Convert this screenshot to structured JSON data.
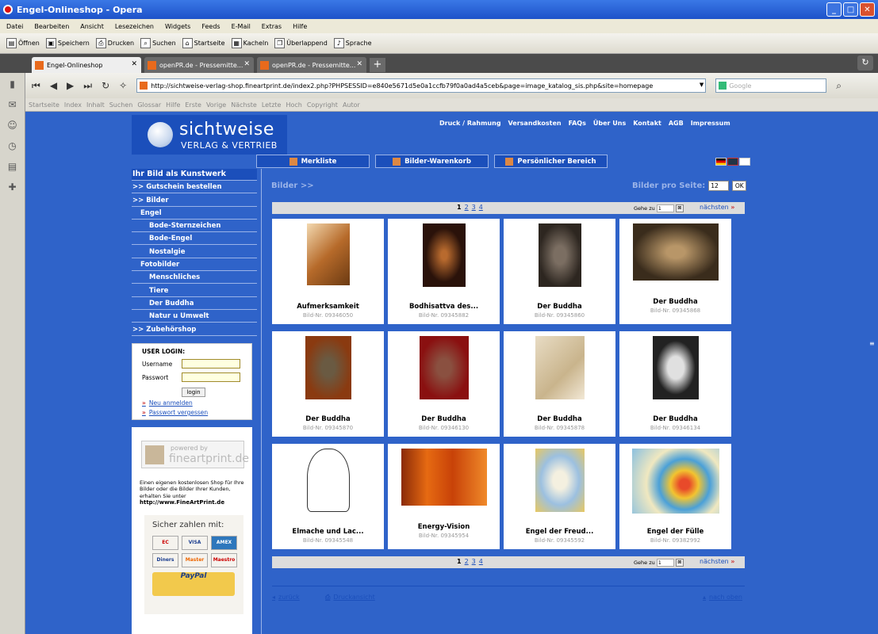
{
  "window": {
    "title": "Engel-Onlineshop - Opera"
  },
  "menu": [
    "Datei",
    "Bearbeiten",
    "Ansicht",
    "Lesezeichen",
    "Widgets",
    "Feeds",
    "E-Mail",
    "Extras",
    "Hilfe"
  ],
  "toolbar": [
    "Öffnen",
    "Speichern",
    "Drucken",
    "Suchen",
    "Startseite",
    "Kacheln",
    "Überlappend",
    "Sprache"
  ],
  "tabs": [
    "Engel-Onlineshop",
    "openPR.de - Pressemitte...",
    "openPR.de - Pressemitte..."
  ],
  "address": {
    "url": "http://sichtweise-verlag-shop.fineartprint.de/index2.php?PHPSESSID=e840e5671d5e0a1ccfb79f0a0ad4a5ceb&page=image_katalog_sis.php&site=homepage",
    "search_placeholder": "Google"
  },
  "navrow": [
    "Startseite",
    "Index",
    "Inhalt",
    "Suchen",
    "Glossar",
    "Hilfe",
    "Erste",
    "Vorige",
    "Nächste",
    "Letzte",
    "Hoch",
    "Copyright",
    "Autor"
  ],
  "logo": {
    "line1": "sichtweise",
    "line2": "VERLAG & VERTRIEB"
  },
  "topnav": [
    "Druck / Rahmung",
    "Versandkosten",
    "FAQs",
    "Über Uns",
    "Kontakt",
    "AGB",
    "Impressum"
  ],
  "actions": [
    "Merkliste",
    "Bilder-Warenkorb",
    "Persönlicher Bereich"
  ],
  "leftnav": [
    {
      "label": "Ihr Bild als Kunstwerk",
      "level": 0
    },
    {
      "label": ">> Gutschein bestellen",
      "level": 0
    },
    {
      "label": ">> Bilder",
      "level": 0
    },
    {
      "label": "Engel",
      "level": 1
    },
    {
      "label": "Bode-Sternzeichen",
      "level": 2
    },
    {
      "label": "Bode-Engel",
      "level": 2
    },
    {
      "label": "Nostalgie",
      "level": 2
    },
    {
      "label": "Fotobilder",
      "level": 1
    },
    {
      "label": "Menschliches",
      "level": 2
    },
    {
      "label": "Tiere",
      "level": 2
    },
    {
      "label": "Der Buddha",
      "level": 2
    },
    {
      "label": "Natur u Umwelt",
      "level": 2
    },
    {
      "label": ">> Zubehörshop",
      "level": 0
    }
  ],
  "login": {
    "heading": "USER LOGIN:",
    "username_label": "Username",
    "password_label": "Passwort",
    "button": "login",
    "register": "Neu anmelden",
    "forgot": "Passwort vergessen"
  },
  "promo": {
    "powered": "powered by",
    "brand": "fineartprint.de",
    "text": "Einen eigenen kostenlosen Shop für Ihre Bilder oder die Bilder Ihrer Kunden, erhalten Sie unter",
    "url": "http://www.FineArtPrint.de"
  },
  "payment": {
    "title": "Sicher zahlen mit:",
    "cards": [
      "EC",
      "VISA",
      "AMEX",
      "Diners",
      "Master",
      "Maestro"
    ],
    "paypal": "PayPal"
  },
  "main": {
    "crumb": "Bilder >>",
    "per_page_label": "Bilder pro Seite:",
    "per_page_value": "12",
    "ok": "OK",
    "pages": [
      "1",
      "2",
      "3",
      "4"
    ],
    "goto_label": "Gehe zu",
    "goto_value": "1",
    "next": "nächsten",
    "back": "zurück",
    "print": "Druckansicht",
    "top": "nach oben"
  },
  "products": [
    {
      "title": "Aufmerksamkeit",
      "id": "Bild-Nr. 09346050"
    },
    {
      "title": "Bodhisattva des...",
      "id": "Bild-Nr. 09345882"
    },
    {
      "title": "Der Buddha",
      "id": "Bild-Nr. 09345860"
    },
    {
      "title": "Der Buddha",
      "id": "Bild-Nr. 09345868"
    },
    {
      "title": "Der Buddha",
      "id": "Bild-Nr. 09345870"
    },
    {
      "title": "Der Buddha",
      "id": "Bild-Nr. 09346130"
    },
    {
      "title": "Der Buddha",
      "id": "Bild-Nr. 09345878"
    },
    {
      "title": "Der Buddha",
      "id": "Bild-Nr. 09346134"
    },
    {
      "title": "Elmache und Lac...",
      "id": "Bild-Nr. 09345548"
    },
    {
      "title": "Energy-Vision",
      "id": "Bild-Nr. 09345954"
    },
    {
      "title": "Engel der Freud...",
      "id": "Bild-Nr. 09345592"
    },
    {
      "title": "Engel der Fülle",
      "id": "Bild-Nr. 09382992"
    }
  ]
}
